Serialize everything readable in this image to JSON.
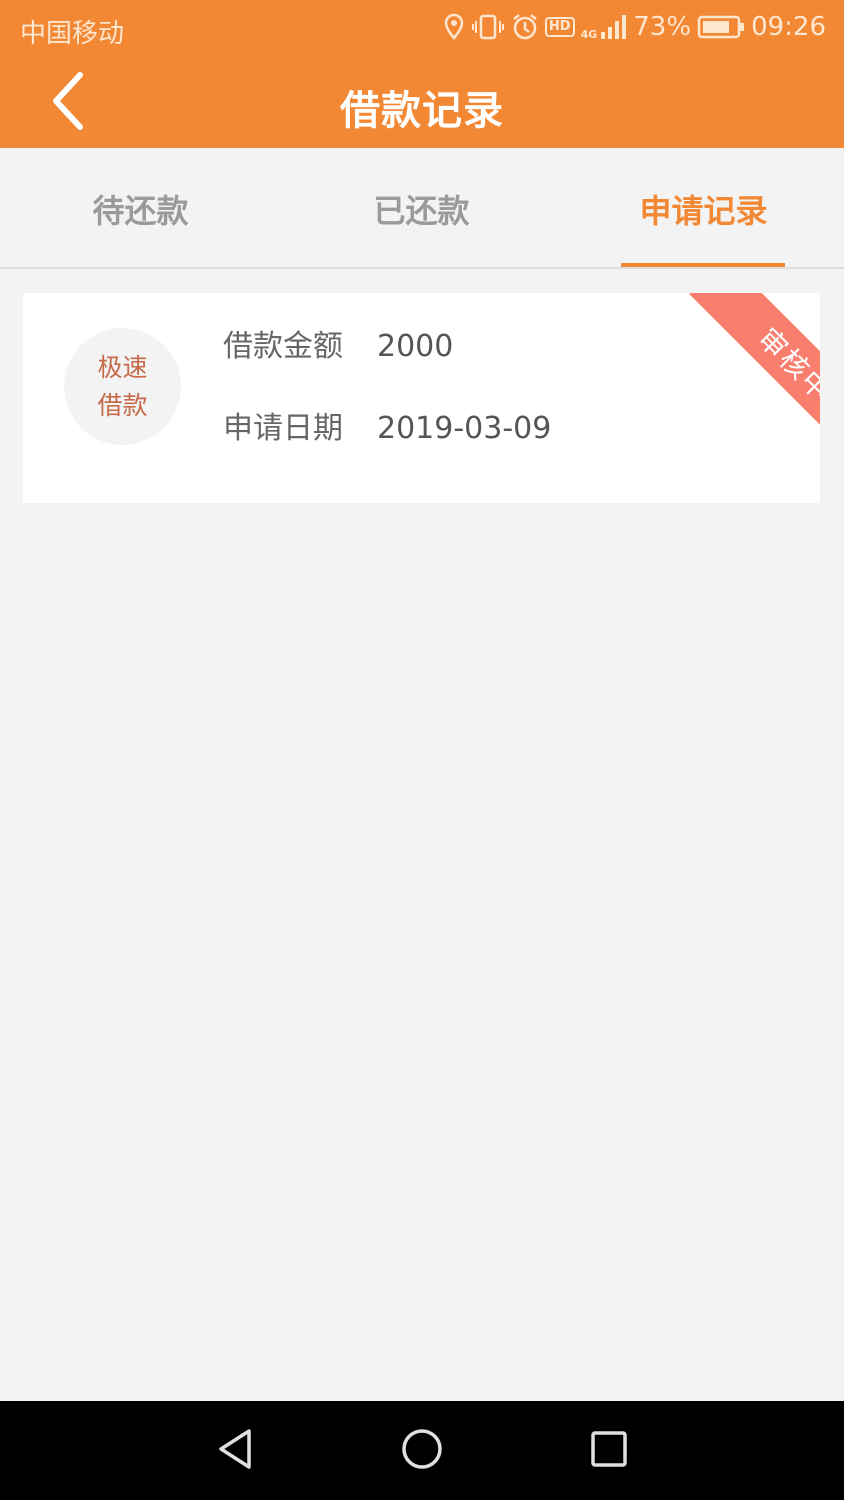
{
  "status_bar": {
    "carrier": "中国移动",
    "hd": "HD",
    "network": "4G",
    "battery": "73%",
    "time": "09:26"
  },
  "header": {
    "title": "借款记录"
  },
  "tabs": [
    {
      "label": "待还款",
      "active": false
    },
    {
      "label": "已还款",
      "active": false
    },
    {
      "label": "申请记录",
      "active": true
    }
  ],
  "records": [
    {
      "type_line1": "极速",
      "type_line2": "借款",
      "amount_label": "借款金额",
      "amount": "2000",
      "date_label": "申请日期",
      "date": "2019-03-09",
      "status": "审核中"
    }
  ],
  "colors": {
    "brand": "#f28834",
    "status_ribbon": "#f87e6e",
    "background": "#f3f3f3"
  },
  "nav_bar": {
    "icons": [
      "back-triangle-icon",
      "home-circle-icon",
      "recents-square-icon"
    ]
  }
}
